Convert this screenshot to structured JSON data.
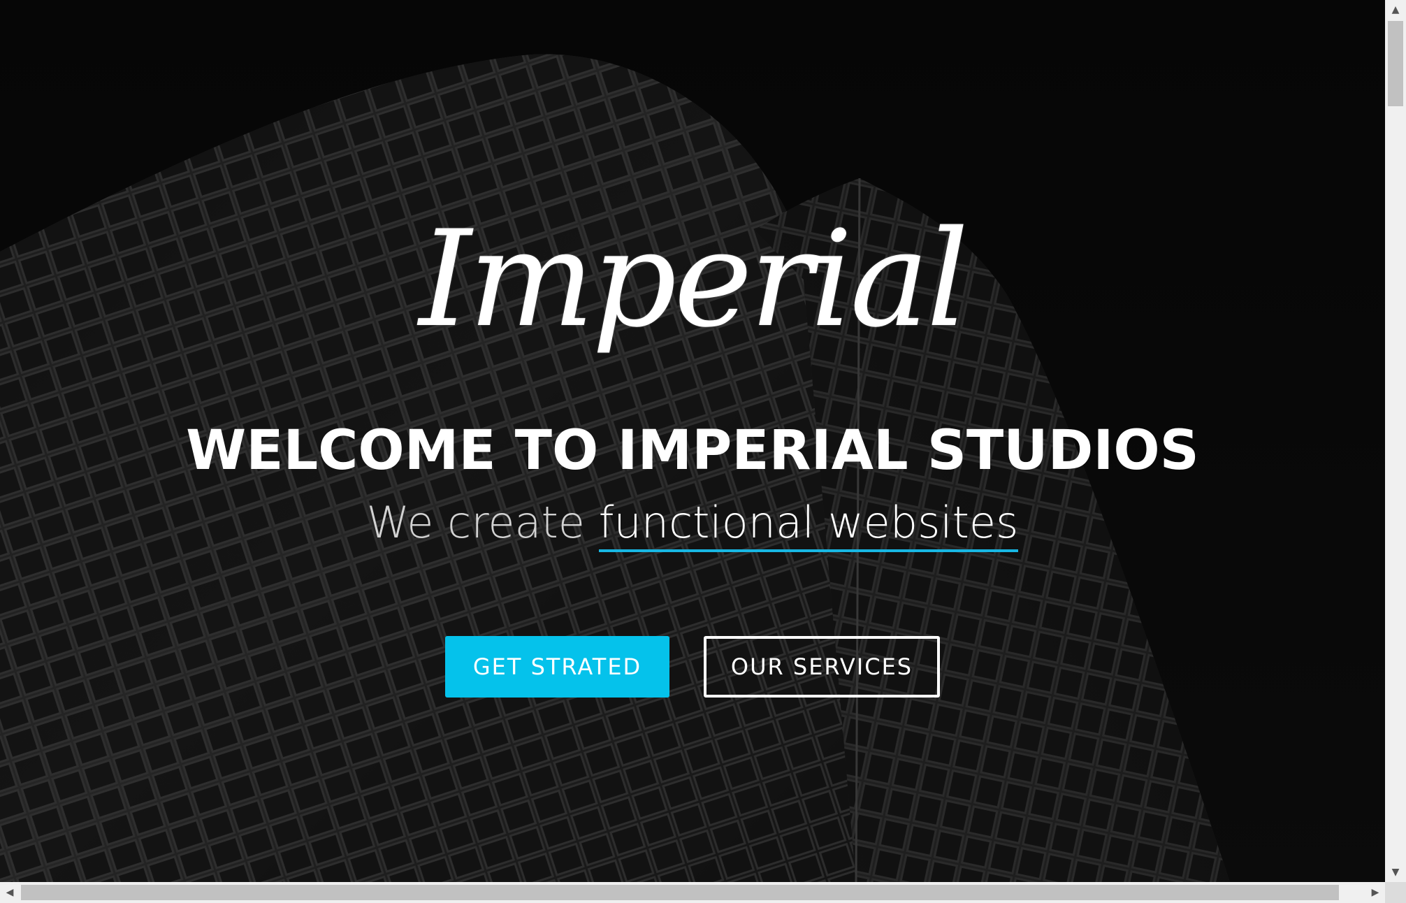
{
  "hero": {
    "logo_text": "Imperial",
    "headline": "WELCOME TO IMPERIAL STUDIOS",
    "tagline_lead": "We create ",
    "tagline_highlight": "functional websites",
    "primary_button_label": "GET STRATED",
    "secondary_button_label": "OUR SERVICES"
  },
  "colors": {
    "accent": "#05c2eb",
    "underline": "#18b7e3",
    "background": "#050505",
    "text": "#ffffff"
  },
  "icons": {
    "scroll_up": "triangle-up-icon",
    "scroll_down": "triangle-down-icon",
    "scroll_left": "triangle-left-icon",
    "scroll_right": "triangle-right-icon"
  }
}
